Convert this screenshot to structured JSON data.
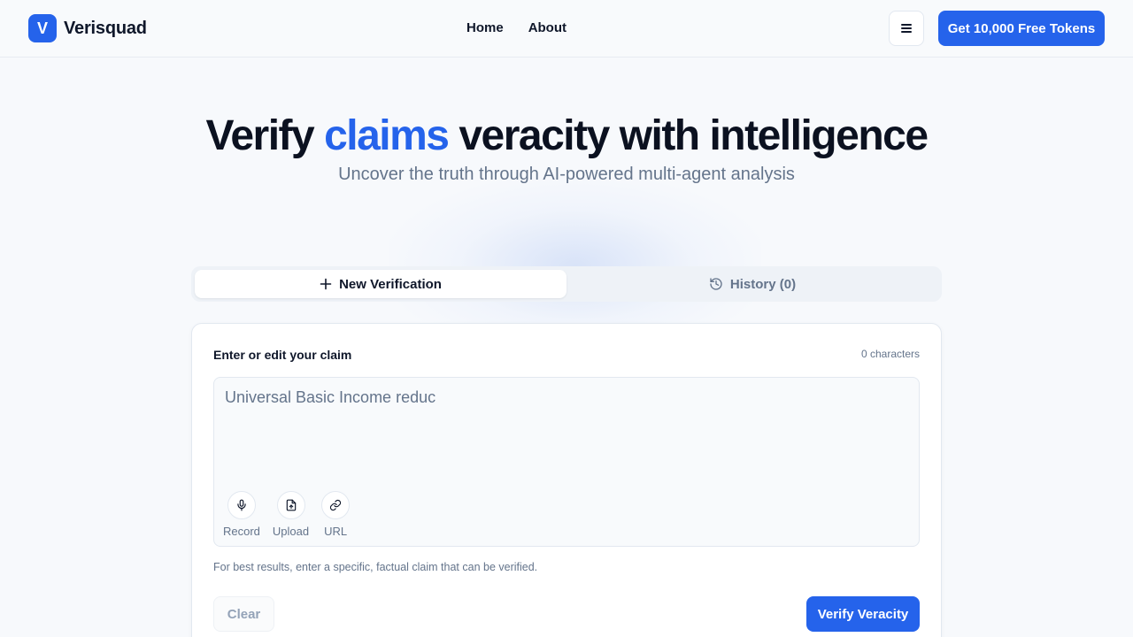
{
  "header": {
    "logo_letter": "V",
    "brand": "Verisquad",
    "nav": [
      "Home",
      "About"
    ],
    "menu_icon": "hamburger-icon",
    "cta_label": "Get 10,000 Free Tokens"
  },
  "hero": {
    "title_before": "Verify ",
    "title_accent": "claims",
    "title_after": " veracity with intelligence",
    "subtitle": "Uncover the truth through AI-powered multi-agent analysis"
  },
  "tabs": {
    "new_label": "New Verification",
    "new_icon": "plus-icon",
    "history_label": "History (0)",
    "history_icon": "history-icon"
  },
  "form": {
    "label": "Enter or edit your claim",
    "char_count": "0 characters",
    "claim_placeholder": "Universal Basic Income reduc",
    "tools": [
      {
        "label": "Record",
        "icon": "microphone-icon"
      },
      {
        "label": "Upload",
        "icon": "file-upload-icon"
      },
      {
        "label": "URL",
        "icon": "link-icon"
      }
    ],
    "hint": "For best results, enter a specific, factual claim that can be verified.",
    "clear_label": "Clear",
    "verify_label": "Verify Veracity"
  },
  "colors": {
    "accent": "#2563eb",
    "text": "#0f172a",
    "muted": "#64748b",
    "background": "#f7f9fc"
  }
}
